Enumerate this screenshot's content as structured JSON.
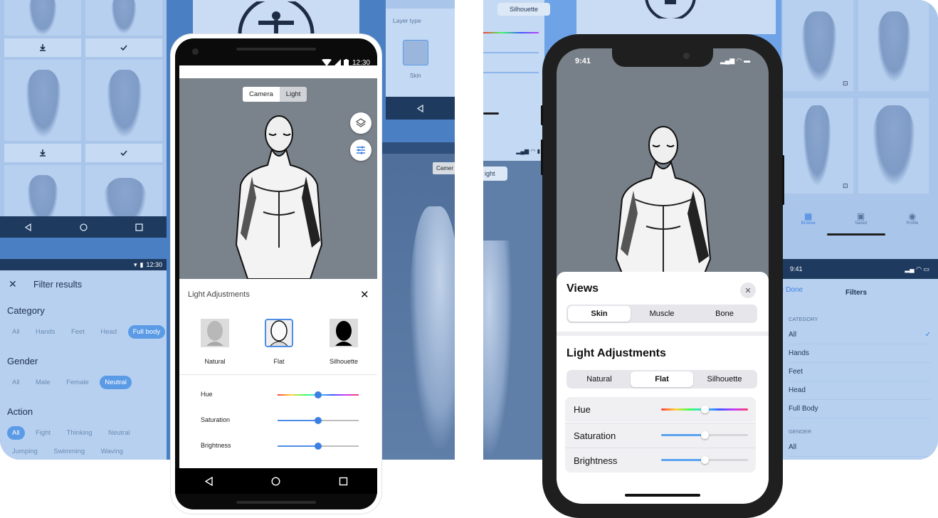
{
  "android": {
    "status_time": "12:30",
    "tabs": [
      "Camera",
      "Light"
    ],
    "panel_title": "Light Adjustments",
    "presets": [
      "Natural",
      "Flat",
      "Silhouette"
    ],
    "sliders": [
      {
        "label": "Hue",
        "value": 0.5
      },
      {
        "label": "Saturation",
        "value": 0.5
      },
      {
        "label": "Brightness",
        "value": 0.5
      }
    ]
  },
  "filter": {
    "status_time": "12:30",
    "title": "Filter results",
    "category_label": "Category",
    "category_options": [
      "All",
      "Hands",
      "Feet",
      "Head",
      "Full body"
    ],
    "gender_label": "Gender",
    "gender_options": [
      "All",
      "Male",
      "Female",
      "Neutral"
    ],
    "action_label": "Action",
    "action_options": [
      "All",
      "Fight",
      "Thinking",
      "Neutral",
      "Jumping",
      "Swimming",
      "Waving"
    ]
  },
  "layer_panel": {
    "title": "Layer type",
    "item": "Skin",
    "tab": "Camer"
  },
  "iphone": {
    "status_time": "9:41",
    "views_title": "Views",
    "views_tabs": [
      "Skin",
      "Muscle",
      "Bone"
    ],
    "light_title": "Light Adjustments",
    "light_tabs": [
      "Natural",
      "Flat",
      "Silhouette"
    ],
    "sliders": [
      {
        "label": "Hue",
        "value": 0.5
      },
      {
        "label": "Saturation",
        "value": 0.5
      },
      {
        "label": "Brightness",
        "value": 0.5
      }
    ]
  },
  "right_bits": {
    "silhouette_label": "Silhouette",
    "light_tab_partial": "ight",
    "tabbar": [
      "Browse",
      "Saved",
      "Profile"
    ]
  },
  "ios_filters": {
    "status_time": "9:41",
    "done_label": "Done",
    "title": "Filters",
    "category_header": "CATEGORY",
    "category_items": [
      "All",
      "Hands",
      "Feet",
      "Head",
      "Full Body"
    ],
    "gender_header": "GENDER",
    "gender_items": [
      "All"
    ]
  }
}
